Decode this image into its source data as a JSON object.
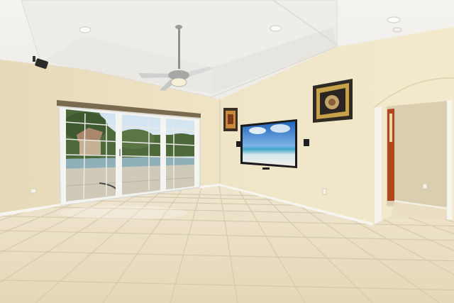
{
  "scene": {
    "kind": "photograph",
    "subject": "empty-living-room-interior",
    "colors": {
      "ceiling": "#f2f0ea",
      "tray_recess": "#eceae3",
      "left_wall": "#ece0c0",
      "back_wall": "#efe5c8",
      "right_wall": "#f1e7cb",
      "floor_tile": "#ece1c6",
      "grout": "#d4c8ab",
      "baseboard": "#f7f5ef",
      "door_frame": "#f4f2ea",
      "curtain_rod": "#7a6a50",
      "tv_bezel": "#1b1b1d",
      "hallway_wall": "#d9cfb0",
      "accent_wall": "#b2461c"
    },
    "objects": [
      "ceiling-fan",
      "recessed-lights",
      "security-camera",
      "sliding-glass-door",
      "curtain-rod",
      "wall-mounted-tv",
      "framed-art-small",
      "framed-art-large",
      "wall-speakers",
      "tile-floor",
      "hallway-doorway"
    ]
  }
}
